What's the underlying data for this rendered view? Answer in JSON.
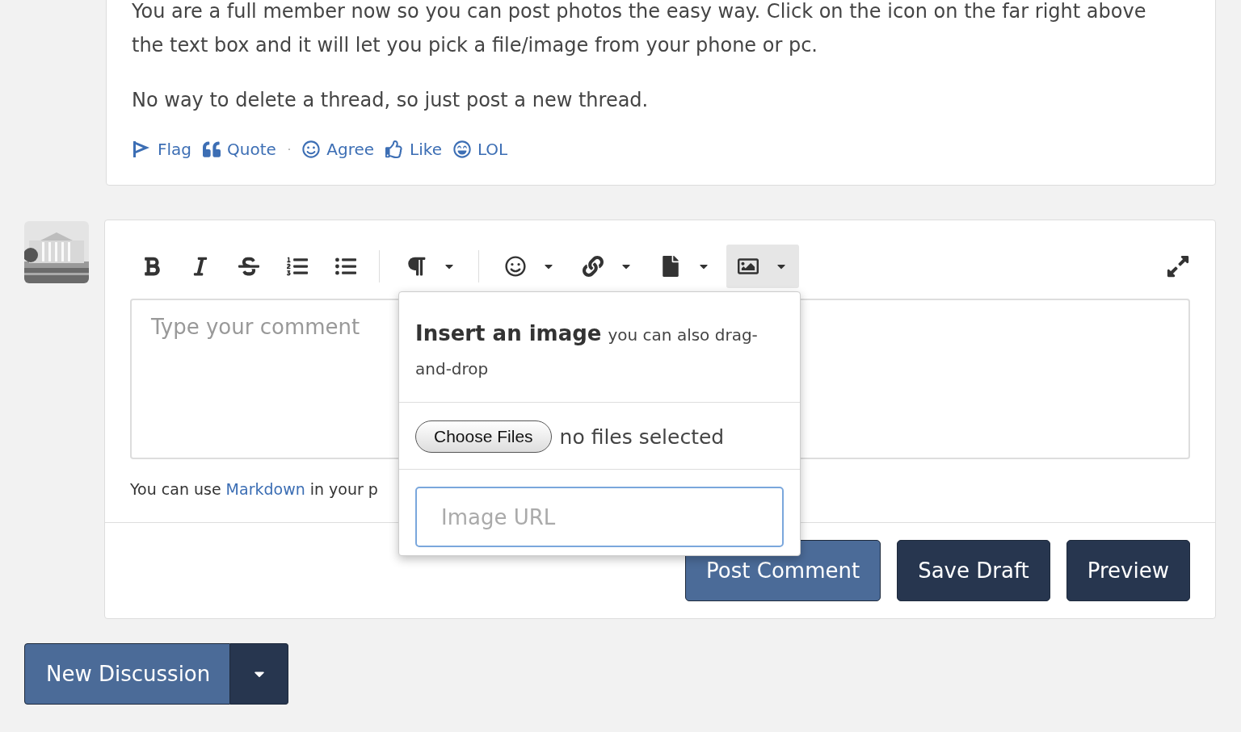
{
  "post": {
    "paragraphs": [
      "You are a full member now so you can post photos the easy way. Click on the icon on the far right above the text box and it will let you pick a file/image from your phone or pc.",
      "No way to delete a thread, so just post a new thread."
    ],
    "reactions": [
      {
        "kind": "action",
        "label": "Flag"
      },
      {
        "kind": "action",
        "label": "Quote"
      },
      {
        "kind": "dot",
        "label": "·"
      },
      {
        "kind": "action",
        "label": "Agree"
      },
      {
        "kind": "action",
        "label": "Like"
      },
      {
        "kind": "action",
        "label": "LOL"
      }
    ]
  },
  "editor": {
    "toolbar": [
      {
        "kind": "tool",
        "dropdown": false,
        "selected": false
      },
      {
        "kind": "tool",
        "dropdown": false,
        "selected": false
      },
      {
        "kind": "tool",
        "dropdown": false,
        "selected": false
      },
      {
        "kind": "tool",
        "dropdown": false,
        "selected": false
      },
      {
        "kind": "tool",
        "dropdown": false,
        "selected": false
      },
      {
        "kind": "separator"
      },
      {
        "kind": "tool",
        "dropdown": true,
        "selected": false
      },
      {
        "kind": "separator"
      },
      {
        "kind": "tool",
        "dropdown": true,
        "selected": false
      },
      {
        "kind": "tool",
        "dropdown": true,
        "selected": false
      },
      {
        "kind": "tool",
        "dropdown": true,
        "selected": false
      },
      {
        "kind": "tool",
        "dropdown": true,
        "selected": true
      }
    ],
    "comment": {
      "placeholder": "Type your comment"
    },
    "hint": {
      "before": "You can use",
      "link": "Markdown",
      "after": "in your p"
    },
    "popup": {
      "title": "Insert an image",
      "subtitle": "you can also drag-and-drop",
      "choose_button": "Choose Files",
      "file_status": "no files selected",
      "url": {
        "placeholder": "Image URL"
      }
    },
    "buttons": [
      {
        "label": "Post Comment",
        "kind": "primary"
      },
      {
        "label": "Save Draft",
        "kind": "dark"
      },
      {
        "label": "Preview",
        "kind": "dark"
      }
    ]
  },
  "new_discussion": {
    "label": "New Discussion"
  }
}
